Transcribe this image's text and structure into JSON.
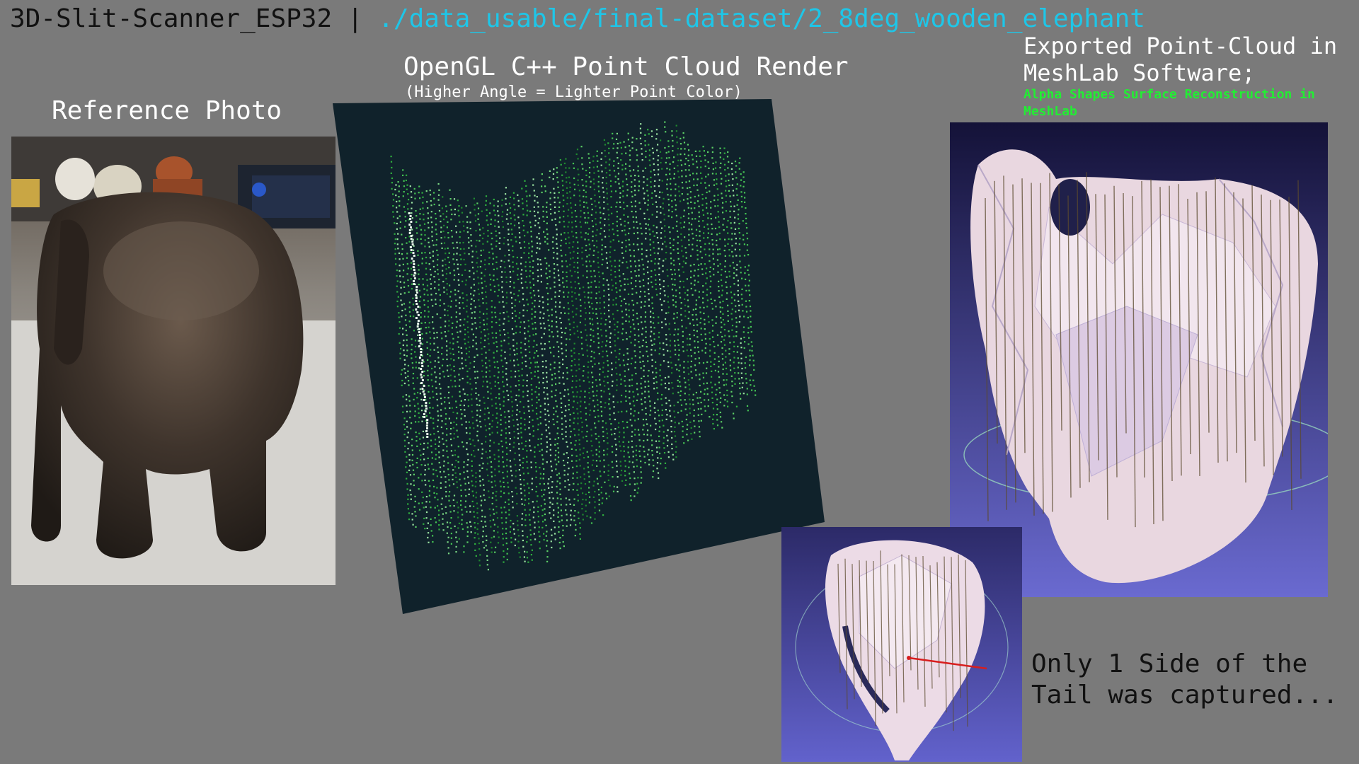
{
  "header": {
    "project": "3D-Slit-Scanner_ESP32",
    "separator": "|",
    "dataset_path": "./data_usable/final-dataset/2_8deg_wooden_elephant"
  },
  "reference": {
    "heading": "Reference Photo"
  },
  "opengl": {
    "heading": "OpenGL C++ Point Cloud Render",
    "subheading": "(Higher Angle = Lighter Point Color)"
  },
  "meshlab": {
    "heading": "Exported Point-Cloud in MeshLab Software;",
    "subheading": "Alpha Shapes Surface Reconstruction in MeshLab"
  },
  "tail_note": {
    "text": "Only 1 Side of the Tail was captured..."
  },
  "colors": {
    "background": "#7a7a7a",
    "path_accent": "#1ec6e8",
    "meshlab_sub_accent": "#22ee33",
    "point_cloud_bg": "#10222b",
    "meshlab_bg_top": "#141238",
    "meshlab_bg_bottom": "#6a6ad0"
  }
}
